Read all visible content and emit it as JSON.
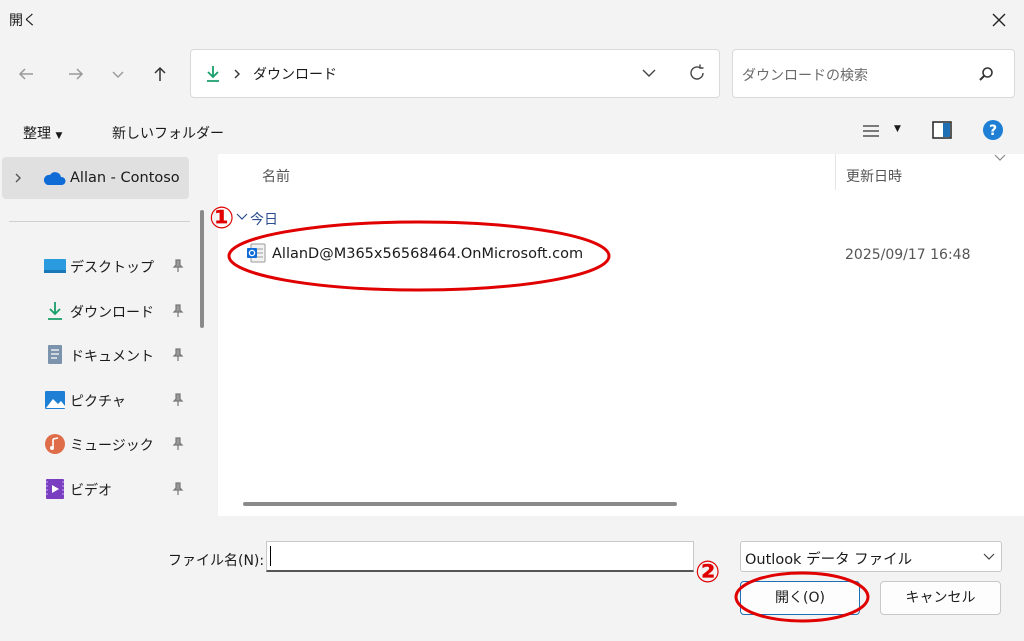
{
  "window": {
    "title": "開く"
  },
  "nav": {
    "address": "ダウンロード",
    "search_placeholder": "ダウンロードの検索"
  },
  "toolbar": {
    "organize": "整理",
    "new_folder": "新しいフォルダー"
  },
  "sidebar": {
    "onedrive": "Allan - Contoso",
    "items": [
      {
        "label": "デスクトップ",
        "icon": "desktop-icon"
      },
      {
        "label": "ダウンロード",
        "icon": "download-icon"
      },
      {
        "label": "ドキュメント",
        "icon": "document-icon"
      },
      {
        "label": "ピクチャ",
        "icon": "pictures-icon"
      },
      {
        "label": "ミュージック",
        "icon": "music-icon"
      },
      {
        "label": "ビデオ",
        "icon": "video-icon"
      }
    ]
  },
  "files": {
    "columns": {
      "name": "名前",
      "date": "更新日時"
    },
    "group": "今日",
    "rows": [
      {
        "name": "AllanD@M365x56568464.OnMicrosoft.com",
        "date": "2025/09/17 16:48"
      }
    ]
  },
  "bottom": {
    "filename_label": "ファイル名(N):",
    "filename_value": "",
    "filetype": "Outlook データ ファイル",
    "open": "開く(O)",
    "cancel": "キャンセル"
  },
  "annotations": {
    "step1": "①",
    "step2": "②"
  },
  "colors": {
    "accent": "#0067c0",
    "annotation": "#e00000",
    "download_green": "#1a9e6a"
  }
}
